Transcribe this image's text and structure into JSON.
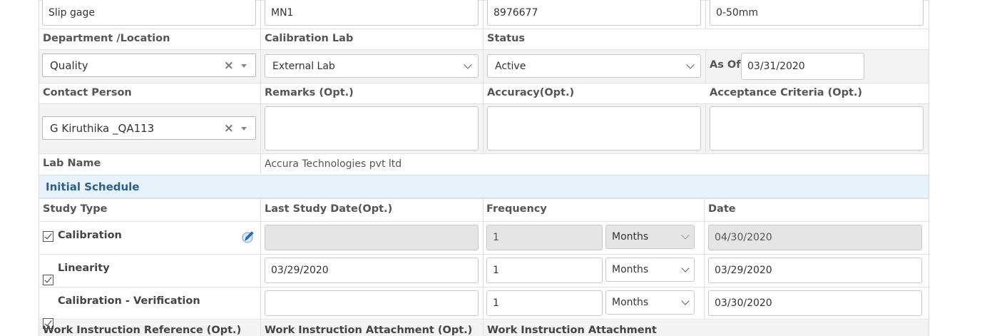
{
  "top_row": {
    "instrument": "Slip gage",
    "model": "MN1",
    "serial": "8976677",
    "range": "0-50mm"
  },
  "row2_labels": {
    "department": "Department /Location",
    "calibration_lab": "Calibration Lab",
    "status": "Status"
  },
  "row2_values": {
    "department": "Quality",
    "calibration_lab": "External Lab",
    "status": "Active",
    "as_of_label": "As Of",
    "as_of": "03/31/2020"
  },
  "row3_labels": {
    "contact_person": "Contact Person",
    "remarks": "Remarks (Opt.)",
    "accuracy": "Accuracy(Opt.)",
    "acceptance": "Acceptance Criteria (Opt.)"
  },
  "row3_values": {
    "contact_person": "G Kiruthika _QA113"
  },
  "lab_name": {
    "label": "Lab Name",
    "value": "Accura Technologies pvt ltd"
  },
  "initial_schedule": {
    "title": "Initial Schedule",
    "headers": {
      "study_type": "Study Type",
      "last_study_date": "Last Study Date(Opt.)",
      "frequency": "Frequency",
      "date": "Date"
    },
    "rows": [
      {
        "study_type": "Calibration",
        "last_study_date": "",
        "frequency": "1",
        "unit": "Months",
        "date": "04/30/2020"
      },
      {
        "study_type": "Linearity",
        "last_study_date": "03/29/2020",
        "frequency": "1",
        "unit": "Months",
        "date": "03/29/2020"
      },
      {
        "study_type": "Calibration - Verification",
        "last_study_date": "",
        "frequency": "1",
        "unit": "Months",
        "date": "03/30/2020"
      }
    ]
  },
  "bottom_labels": {
    "wi_reference": "Work Instruction Reference (Opt.)",
    "wi_attachment_opt": "Work Instruction Attachment (Opt.)",
    "wi_attachment": "Work Instruction Attachment"
  }
}
